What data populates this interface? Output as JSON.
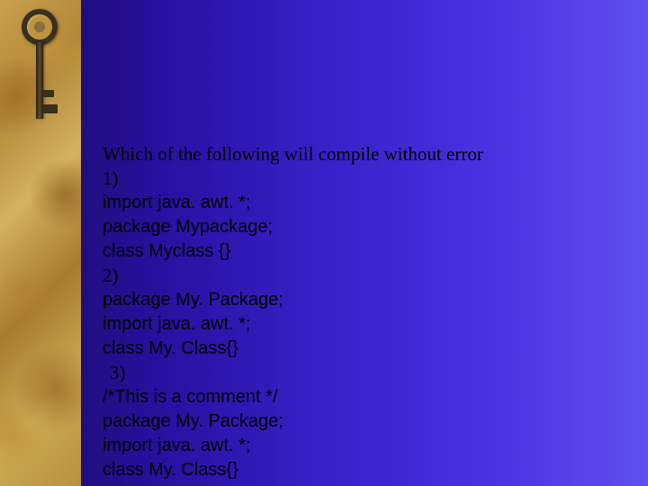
{
  "slide": {
    "question": "Which of the following will compile without error",
    "opt1_num": "1)",
    "opt1_l1": "import java. awt. *;",
    "opt1_l2": "package Mypackage;",
    "opt1_l3": "class Myclass {}",
    "opt2_num": "2)",
    "opt2_l1": "package My. Package;",
    "opt2_l2": "import java. awt. *;",
    "opt2_l3": "class My. Class{}",
    "opt3_num": " 3)",
    "opt3_l1": "/*This is a comment */",
    "opt3_l2": "package My. Package;",
    "opt3_l3": "import java. awt. *;",
    "opt3_l4": "class My. Class{}"
  }
}
